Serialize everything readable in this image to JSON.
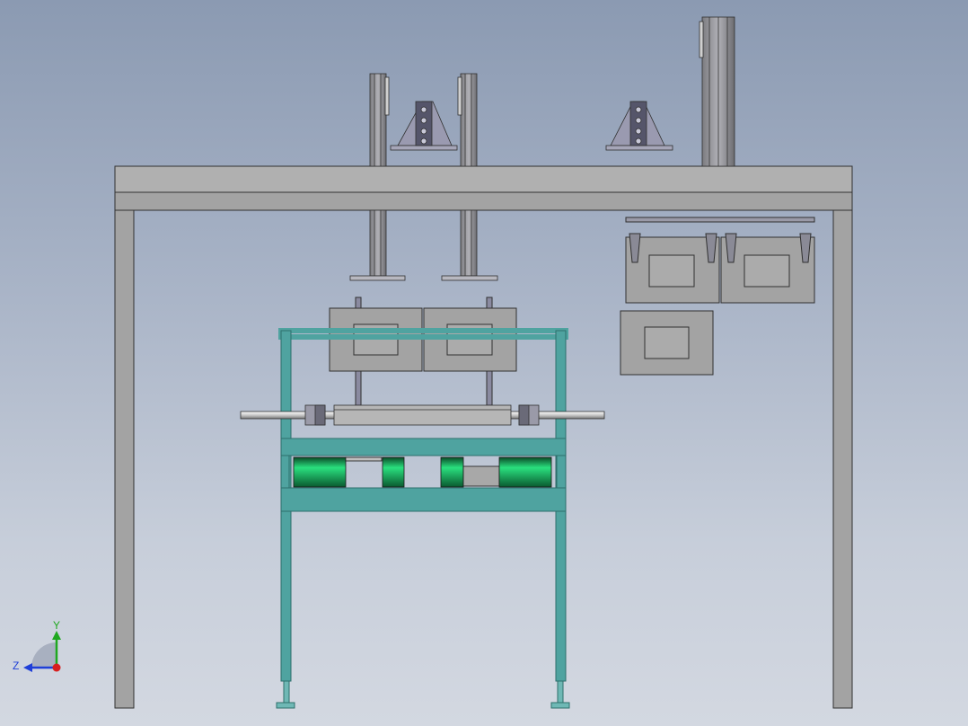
{
  "viewport": {
    "background_top": "#8b9ab2",
    "background_bottom": "#d3d8e1"
  },
  "colors": {
    "frame_gray": "#a3a3a3",
    "frame_light": "#b4b4b4",
    "cart_teal": "#4fa3a0",
    "cart_teal_dark": "#2e6f6c",
    "motor_green": "#1fbf6a",
    "shaft_silver": "#d8d8d8",
    "outline": "#303030"
  },
  "triad": {
    "x_label": "",
    "y_label": "Y",
    "z_label": "Z",
    "y_color": "#1fa81f",
    "z_color": "#1f3fd8",
    "origin_color": "#d81f1f"
  }
}
